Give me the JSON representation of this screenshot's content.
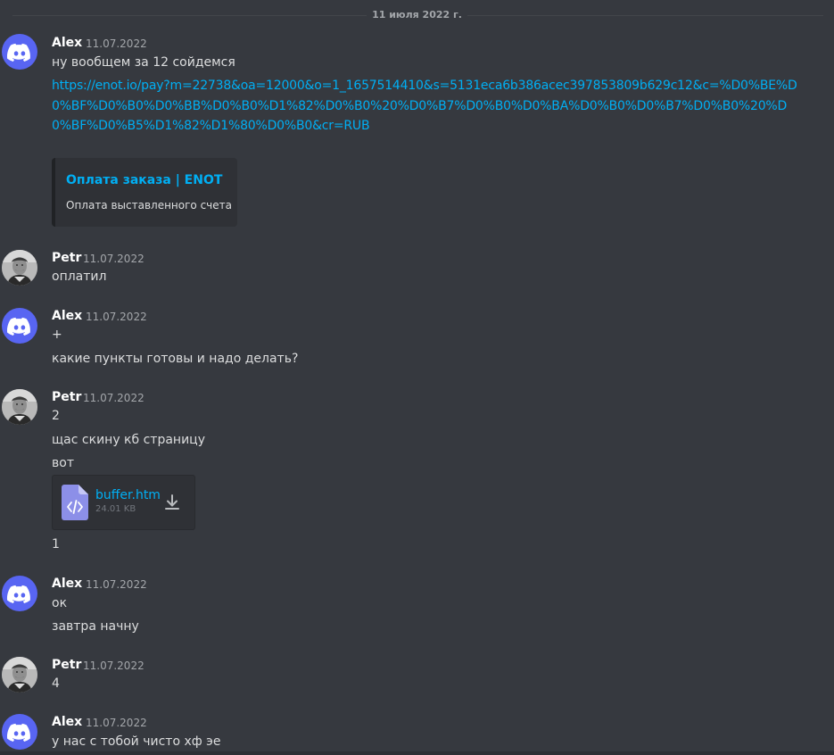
{
  "date_divider": "11 июля 2022 г.",
  "colors": {
    "background": "#36393f",
    "link": "#00aff4",
    "discord_blurple": "#5865f2",
    "embed_bg": "#2f3136"
  },
  "messages": [
    {
      "author": "Alex",
      "timestamp": "11.07.2022",
      "avatar_icon": "discord-logo-icon",
      "lines": [
        "ну вообщем за 12 сойдемся"
      ],
      "link": "https://enot.io/pay?m=22738&oa=12000&o=1_1657514410&s=5131eca6b386acec397853809b629c12&c=%D0%BE%D0%BF%D0%B0%D0%BB%D0%B0%D1%82%D0%B0%20%D0%B7%D0%B0%D0%BA%D0%B0%D0%B7%D0%B0%20%D0%BF%D0%B5%D1%82%D1%80%D0%B0&cr=RUB",
      "embed": {
        "title": "Оплата заказа | ENOT",
        "description": "Оплата выставленного счета"
      }
    },
    {
      "author": "Petr",
      "timestamp": "11.07.2022",
      "avatar_icon": "user-photo-avatar",
      "lines": [
        "оплатил"
      ]
    },
    {
      "author": "Alex",
      "timestamp": "11.07.2022",
      "avatar_icon": "discord-logo-icon",
      "lines": [
        "+",
        "какие пункты готовы и надо делать?"
      ]
    },
    {
      "author": "Petr",
      "timestamp": "11.07.2022",
      "avatar_icon": "user-photo-avatar",
      "lines": [
        "2",
        "щас скину кб страницу",
        "вот",
        "1"
      ],
      "attachment": {
        "filename": "buffer.htm",
        "size": "24.01 KB",
        "icon": "code-file-icon",
        "download_icon": "download-icon"
      }
    },
    {
      "author": "Alex",
      "timestamp": "11.07.2022",
      "avatar_icon": "discord-logo-icon",
      "lines": [
        "ок",
        "завтра начну"
      ]
    },
    {
      "author": "Petr",
      "timestamp": "11.07.2022",
      "avatar_icon": "user-photo-avatar",
      "lines": [
        "4"
      ]
    },
    {
      "author": "Alex",
      "timestamp": "11.07.2022",
      "avatar_icon": "discord-logo-icon",
      "lines": [
        "у нас с тобой чисто хф эе"
      ]
    }
  ]
}
